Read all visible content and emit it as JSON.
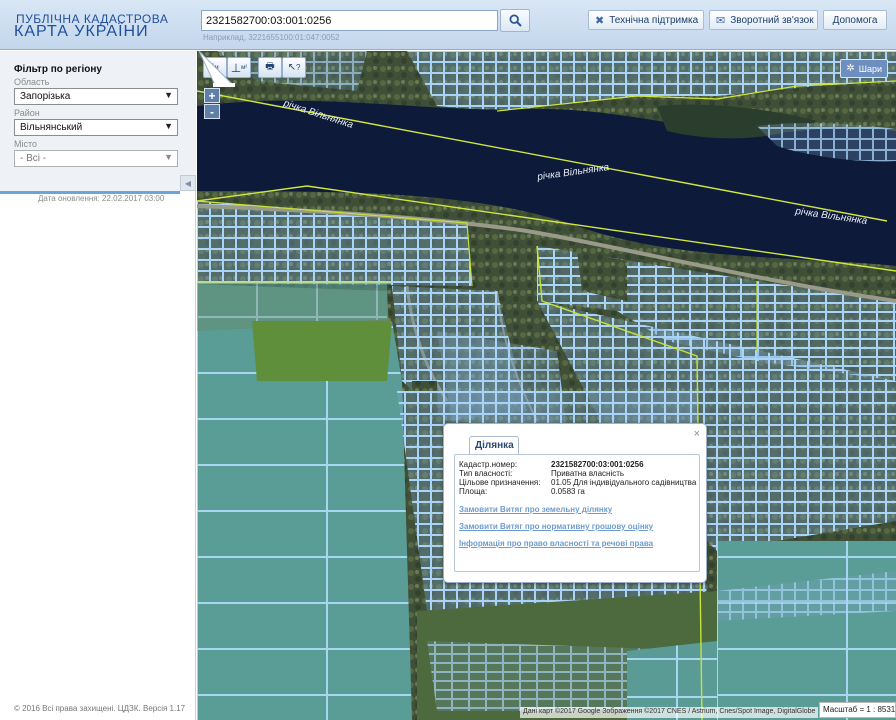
{
  "header": {
    "logo_line1": "ПУБЛІЧНА КАДАСТРОВА",
    "logo_line2": "КАРТА УКРАЇНИ",
    "search_value": "2321582700:03:001:0256",
    "search_hint": "Наприклад, 3221655100:01:047:0052",
    "search_icon": "magnifier-icon",
    "buttons": [
      {
        "label": "Технічна підтримка",
        "icon": "tools-icon"
      },
      {
        "label": "Зворотний зв'язок",
        "icon": "envelope-icon"
      },
      {
        "label": "Допомога",
        "icon": ""
      }
    ]
  },
  "sidebar": {
    "filter_title": "Фільтр по регіону",
    "region_label": "Область",
    "region_value": "Запорізька",
    "district_label": "Район",
    "district_value": "Вільнянський",
    "city_label": "Місто",
    "city_value": "- Всі -",
    "update_date": "Дата оновлення: 22.02.2017 03:00",
    "copyright": "© 2016 Всі права захищені. ЦДЗК. Версія 1.17"
  },
  "map": {
    "toolbar": [
      {
        "label": "м",
        "icon": "ruler-line-icon"
      },
      {
        "label": "м²",
        "icon": "ruler-area-icon"
      },
      {
        "label": "",
        "icon": "print-icon"
      },
      {
        "label": "?",
        "icon": "info-cursor-icon"
      }
    ],
    "zoom_in": "+",
    "zoom_out": "-",
    "layers_label": "Шари",
    "river_label_1": "річка Вільнянка",
    "river_label_2": "річка Вільнянка",
    "river_label_3": "річка Вільнянка",
    "attribution": "Дані карт ©2017 Google Зображення ©2017 CNES / Astrium, Cnes/Spot Image, DigitalGlobe",
    "scale": "Масштаб = 1 : 8531"
  },
  "popup": {
    "tab_label": "Ділянка",
    "close_glyph": "×",
    "fields": [
      {
        "key": "Кадастр.номер:",
        "value": "2321582700:03:001:0256",
        "bold": true
      },
      {
        "key": "Тип власності:",
        "value": "Приватна власність",
        "bold": false
      },
      {
        "key": "Цільове призначення:",
        "value": "01.05 Для індивідуального садівництва",
        "bold": false
      },
      {
        "key": "Площа:",
        "value": "0.0583 га",
        "bold": false
      }
    ],
    "links": [
      "Замовити Витяг про земельну ділянку",
      "Замовити Витяг про нормативну грошову оцінку",
      "Інформація про право власності та речові права"
    ]
  },
  "colors": {
    "river": "#0d1a3a",
    "parcel_stroke": "#8fc3f2",
    "boundary": "#c7e23a",
    "field": "#4e8e8c"
  }
}
